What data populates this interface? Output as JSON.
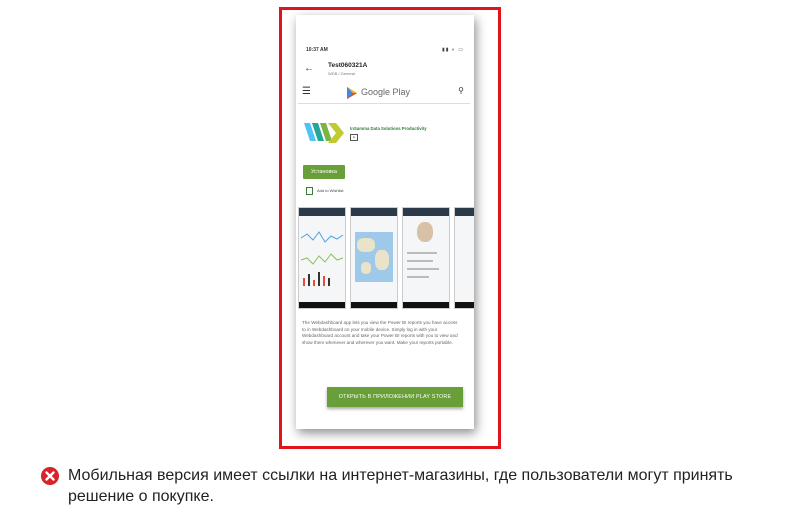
{
  "phone": {
    "status_time": "10:37 AM",
    "status_icons": "▮▮ ◐ ▭",
    "back_icon": "arrow-left",
    "title": "Test060321A",
    "subtitle": "WDB / General",
    "store_name": "Google Play",
    "developer": "InSumma Data Solutions    Productivity",
    "install_label": "Установка",
    "wishlist_label": "Add to Wishlist",
    "description": "The Webdashboard app lets you view the Power BI reports you have access to in Webdashboard on your mobile device. Simply log in with your Webdashboard account and take your Power BI reports with you to view and show them whenever and wherever you want. Make your reports portable.",
    "open_button": "ОТКРЫТЬ В ПРИЛОЖЕНИИ PLAY STORE"
  },
  "caption": {
    "icon": "x-error-icon",
    "text": "Мобильная версия имеет ссылки на интернет-магазины, где пользователи могут принять решение о покупке."
  },
  "colors": {
    "frame": "#e0141b",
    "green": "#689f38",
    "error": "#d8232a"
  }
}
